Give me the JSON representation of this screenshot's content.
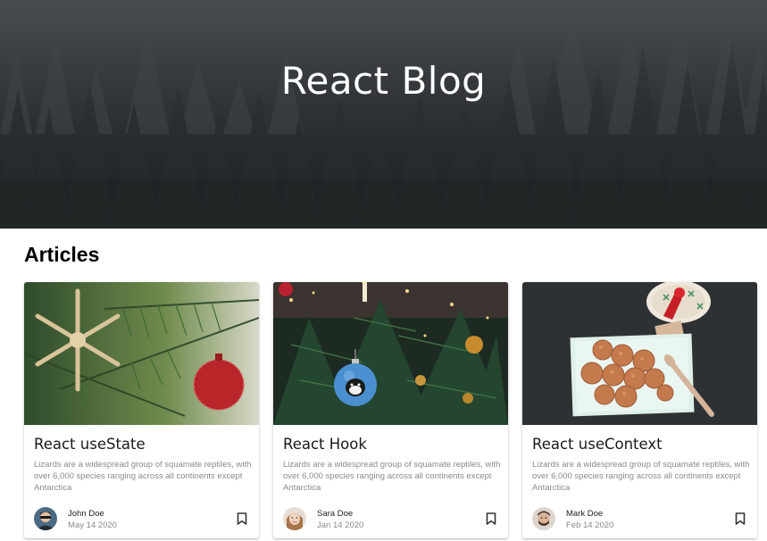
{
  "hero": {
    "title": "React Blog"
  },
  "section": {
    "title": "Articles"
  },
  "cards": [
    {
      "title": "React useState",
      "description": "Lizards are a widespread group of squamate reptiles, with over 6,000 species ranging across all continents except Antarctica",
      "author": "John Doe",
      "date": "May 14 2020",
      "image": "christmas-branch-snowflake-ornament",
      "bookmark_icon": "bookmark-icon"
    },
    {
      "title": "React Hook",
      "description": "Lizards are a widespread group of squamate reptiles, with over 6,000 species ranging across all continents except Antarctica",
      "author": "Sara Doe",
      "date": "Jan 14 2020",
      "image": "christmas-tree-ornaments",
      "bookmark_icon": "bookmark-icon"
    },
    {
      "title": "React useContext",
      "description": "Lizards are a widespread group of squamate reptiles, with over 6,000 species ranging across all continents except Antarctica",
      "author": "Mark Doe",
      "date": "Feb 14 2020",
      "image": "cookies-on-plate",
      "bookmark_icon": "bookmark-icon"
    }
  ],
  "colors": {
    "hero_overlay": "#2b2f31",
    "title_text": "#ffffff",
    "card_desc": "#8a8a8a"
  }
}
